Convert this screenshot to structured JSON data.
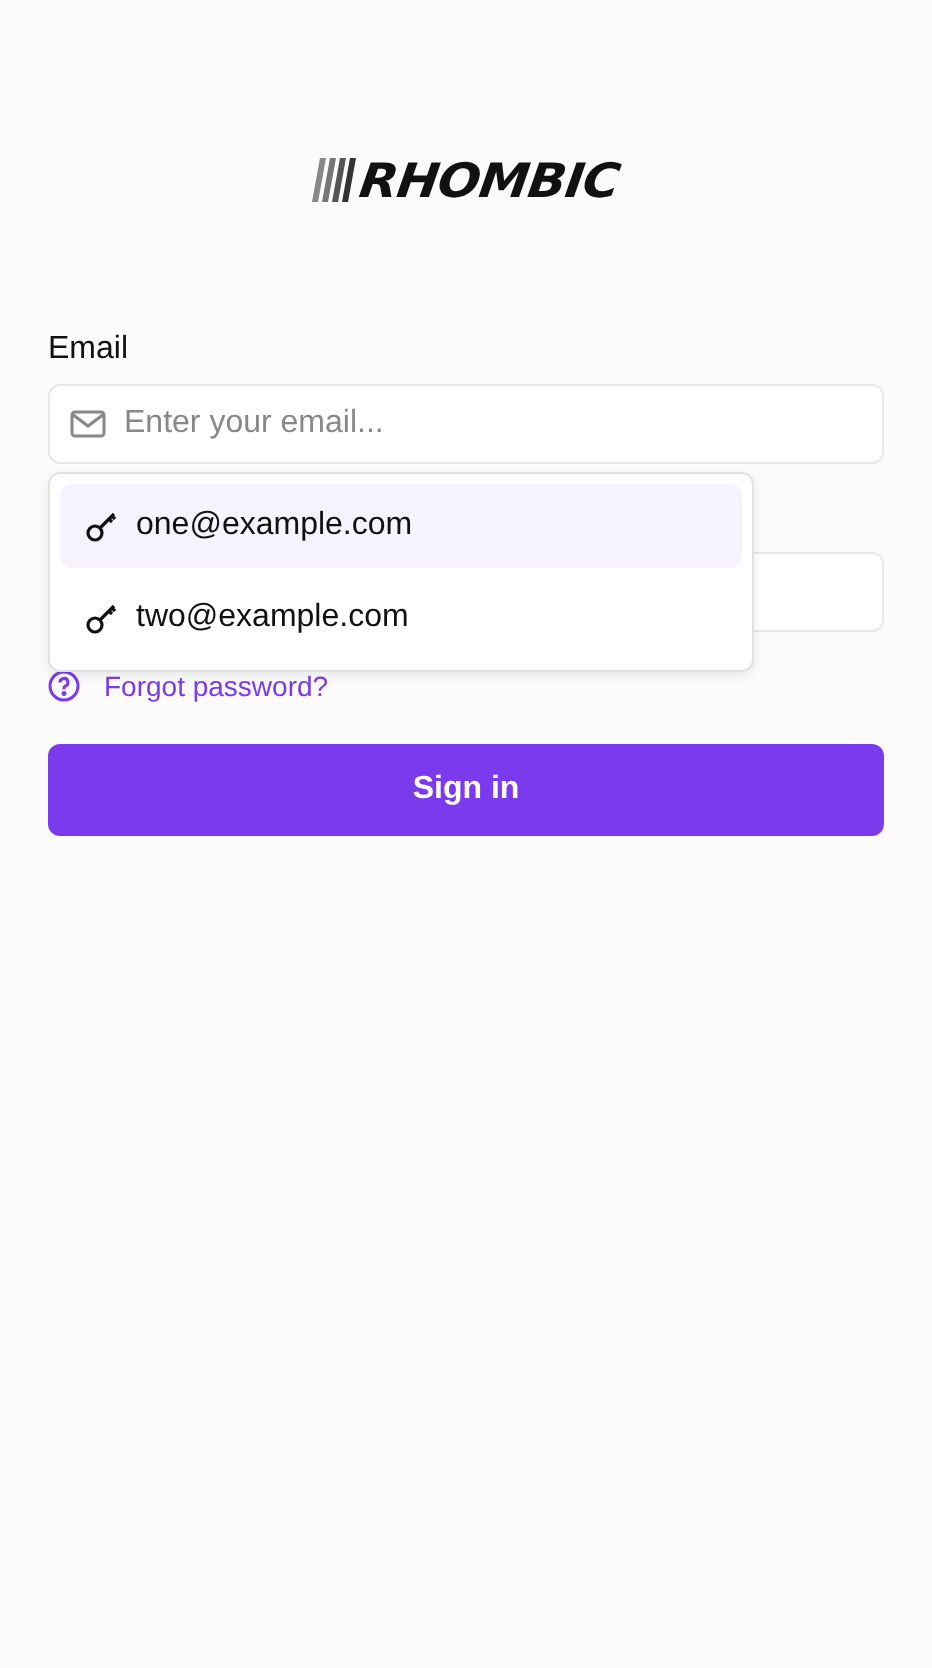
{
  "logo": {
    "text": "RHOMBIC"
  },
  "email": {
    "label": "Email",
    "placeholder": "Enter your email..."
  },
  "suggestions": [
    {
      "text": "one@example.com",
      "selected": true
    },
    {
      "text": "two@example.com",
      "selected": false
    }
  ],
  "forgot_link": "Forgot password?",
  "submit": "Sign in"
}
